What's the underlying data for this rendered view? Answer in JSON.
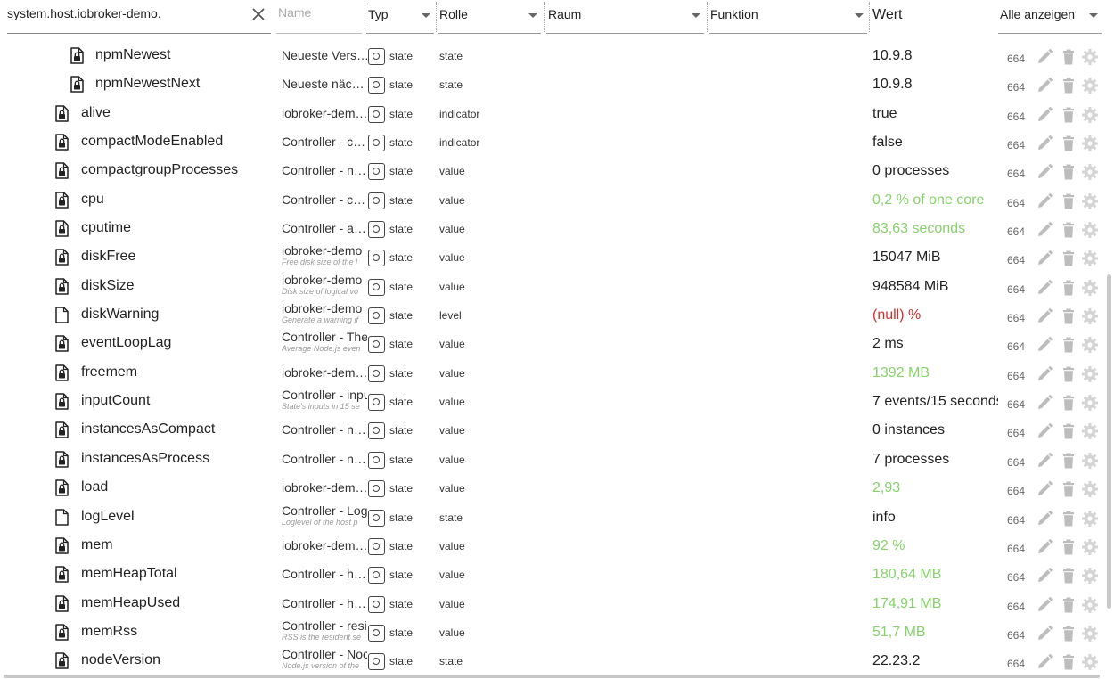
{
  "filters": {
    "path_value": "system.host.iobroker-demo.",
    "name_placeholder": "Name",
    "typ_label": "Typ",
    "rolle_label": "Rolle",
    "raum_label": "Raum",
    "funktion_label": "Funktion",
    "wert_label": "Wert",
    "alle_label": "Alle anzeigen"
  },
  "rows": [
    {
      "name": "npmNewest",
      "desc": "Neueste Vers…",
      "sub": "",
      "type": "state",
      "role": "state",
      "value": "10.9.8",
      "unit": "",
      "color": "",
      "acl": "664",
      "indent": 2,
      "lock": true
    },
    {
      "name": "npmNewestNext",
      "desc": "Neueste näc…",
      "sub": "",
      "type": "state",
      "role": "state",
      "value": "10.9.8",
      "unit": "",
      "color": "",
      "acl": "664",
      "indent": 2,
      "lock": true
    },
    {
      "name": "alive",
      "desc": "iobroker-dem…",
      "sub": "",
      "type": "state",
      "role": "indicator",
      "value": "true",
      "unit": "",
      "color": "",
      "acl": "664",
      "indent": 1,
      "lock": true
    },
    {
      "name": "compactModeEnabled",
      "desc": "Controller - c…",
      "sub": "",
      "type": "state",
      "role": "indicator",
      "value": "false",
      "unit": "",
      "color": "",
      "acl": "664",
      "indent": 1,
      "lock": true
    },
    {
      "name": "compactgroupProcesses",
      "desc": "Controller - n…",
      "sub": "",
      "type": "state",
      "role": "value",
      "value": "0",
      "unit": " processes",
      "color": "",
      "acl": "664",
      "indent": 1,
      "lock": true
    },
    {
      "name": "cpu",
      "desc": "Controller - c…",
      "sub": "",
      "type": "state",
      "role": "value",
      "value": "0,2",
      "unit": " % of one core",
      "color": "green",
      "acl": "664",
      "indent": 1,
      "lock": true
    },
    {
      "name": "cputime",
      "desc": "Controller - a…",
      "sub": "",
      "type": "state",
      "role": "value",
      "value": "83,63",
      "unit": " seconds",
      "color": "green",
      "acl": "664",
      "indent": 1,
      "lock": true
    },
    {
      "name": "diskFree",
      "desc": "iobroker-demo",
      "sub": "Free disk size of the l",
      "type": "state",
      "role": "value",
      "value": "15047",
      "unit": " MiB",
      "color": "",
      "acl": "664",
      "indent": 1,
      "lock": true
    },
    {
      "name": "diskSize",
      "desc": "iobroker-demo",
      "sub": "Disk size of logical vo",
      "type": "state",
      "role": "value",
      "value": "948584",
      "unit": " MiB",
      "color": "",
      "acl": "664",
      "indent": 1,
      "lock": true
    },
    {
      "name": "diskWarning",
      "desc": "iobroker-demo",
      "sub": "Generate a warning if",
      "type": "state",
      "role": "level",
      "value": "(null)",
      "unit": " %",
      "color": "red",
      "acl": "664",
      "indent": 1,
      "lock": false
    },
    {
      "name": "eventLoopLag",
      "desc": "Controller - The",
      "sub": "Average Node.js even",
      "type": "state",
      "role": "value",
      "value": "2",
      "unit": " ms",
      "color": "",
      "acl": "664",
      "indent": 1,
      "lock": true
    },
    {
      "name": "freemem",
      "desc": "iobroker-dem…",
      "sub": "",
      "type": "state",
      "role": "value",
      "value": "1392",
      "unit": " MB",
      "color": "green",
      "acl": "664",
      "indent": 1,
      "lock": true
    },
    {
      "name": "inputCount",
      "desc": "Controller - inpu",
      "sub": "State's inputs in 15 se",
      "type": "state",
      "role": "value",
      "value": "7",
      "unit": " events/15 seconds",
      "color": "",
      "acl": "664",
      "indent": 1,
      "lock": true
    },
    {
      "name": "instancesAsCompact",
      "desc": "Controller - n…",
      "sub": "",
      "type": "state",
      "role": "value",
      "value": "0",
      "unit": " instances",
      "color": "",
      "acl": "664",
      "indent": 1,
      "lock": true
    },
    {
      "name": "instancesAsProcess",
      "desc": "Controller - n…",
      "sub": "",
      "type": "state",
      "role": "value",
      "value": "7",
      "unit": " processes",
      "color": "",
      "acl": "664",
      "indent": 1,
      "lock": true
    },
    {
      "name": "load",
      "desc": "iobroker-dem…",
      "sub": "",
      "type": "state",
      "role": "value",
      "value": "2,93",
      "unit": "",
      "color": "green",
      "acl": "664",
      "indent": 1,
      "lock": true
    },
    {
      "name": "logLevel",
      "desc": "Controller - Log",
      "sub": "Loglevel of the host p",
      "type": "state",
      "role": "state",
      "value": "info",
      "unit": "",
      "color": "",
      "acl": "664",
      "indent": 1,
      "lock": false
    },
    {
      "name": "mem",
      "desc": "iobroker-dem…",
      "sub": "",
      "type": "state",
      "role": "value",
      "value": "92",
      "unit": " %",
      "color": "green",
      "acl": "664",
      "indent": 1,
      "lock": true
    },
    {
      "name": "memHeapTotal",
      "desc": "Controller - h…",
      "sub": "",
      "type": "state",
      "role": "value",
      "value": "180,64",
      "unit": " MB",
      "color": "green",
      "acl": "664",
      "indent": 1,
      "lock": true
    },
    {
      "name": "memHeapUsed",
      "desc": "Controller - h…",
      "sub": "",
      "type": "state",
      "role": "value",
      "value": "174,91",
      "unit": " MB",
      "color": "green",
      "acl": "664",
      "indent": 1,
      "lock": true
    },
    {
      "name": "memRss",
      "desc": "Controller - resi",
      "sub": "RSS is the resident se",
      "type": "state",
      "role": "value",
      "value": "51,7",
      "unit": " MB",
      "color": "green",
      "acl": "664",
      "indent": 1,
      "lock": true
    },
    {
      "name": "nodeVersion",
      "desc": "Controller - Noc",
      "sub": "Node.js version of the",
      "type": "state",
      "role": "state",
      "value": "22.23.2",
      "unit": "",
      "color": "",
      "acl": "664",
      "indent": 1,
      "lock": true
    }
  ]
}
